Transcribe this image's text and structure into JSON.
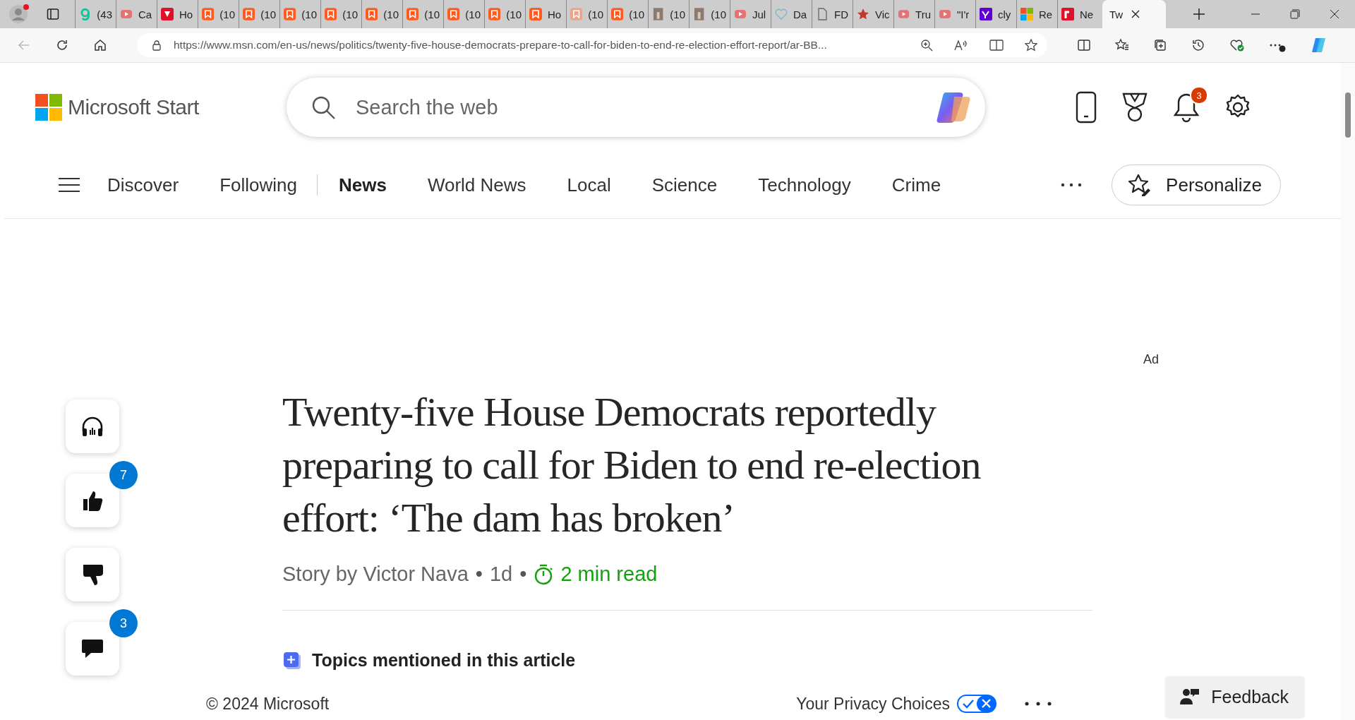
{
  "browser": {
    "tabs": [
      {
        "title": "(43",
        "kind": "grammar",
        "selected": false
      },
      {
        "title": "Ca",
        "kind": "video",
        "selected": false
      },
      {
        "title": "Ho",
        "kind": "shield",
        "selected": false
      },
      {
        "title": "(10",
        "kind": "bookmark",
        "selected": false
      },
      {
        "title": "(10",
        "kind": "bookmark",
        "selected": false
      },
      {
        "title": "(10",
        "kind": "bookmark",
        "selected": false
      },
      {
        "title": "(10",
        "kind": "bookmark",
        "selected": false
      },
      {
        "title": "(10",
        "kind": "bookmark",
        "selected": false
      },
      {
        "title": "(10",
        "kind": "bookmark",
        "selected": false
      },
      {
        "title": "(10",
        "kind": "bookmark",
        "selected": false
      },
      {
        "title": "(10",
        "kind": "bookmark",
        "selected": false
      },
      {
        "title": "Ho",
        "kind": "bookmark",
        "selected": false
      },
      {
        "title": "(10",
        "kind": "bookmark-faded",
        "selected": false
      },
      {
        "title": "(10",
        "kind": "bookmark",
        "selected": false
      },
      {
        "title": "(10",
        "kind": "candle",
        "selected": false
      },
      {
        "title": "(10",
        "kind": "candle",
        "selected": false
      },
      {
        "title": "Jul",
        "kind": "video",
        "selected": false
      },
      {
        "title": "Da",
        "kind": "heart",
        "selected": false
      },
      {
        "title": "FD",
        "kind": "document",
        "selected": false
      },
      {
        "title": "Vic",
        "kind": "star",
        "selected": false
      },
      {
        "title": "Tru",
        "kind": "video",
        "selected": false
      },
      {
        "title": "\"I'r",
        "kind": "video",
        "selected": false
      },
      {
        "title": "cly",
        "kind": "yahoo",
        "selected": false
      },
      {
        "title": "Re",
        "kind": "windows",
        "selected": false
      },
      {
        "title": "Ne",
        "kind": "r",
        "selected": false
      },
      {
        "title": "Tw",
        "kind": "plain",
        "selected": true
      }
    ],
    "url": "https://www.msn.com/en-us/news/politics/twenty-five-house-democrats-prepare-to-call-for-biden-to-end-re-election-effort-report/ar-BB..."
  },
  "header": {
    "brand": "Microsoft Start",
    "search": {
      "placeholder": "Search the web"
    },
    "notification_count": "3"
  },
  "nav": {
    "items": [
      {
        "label": "Discover",
        "selected": false
      },
      {
        "label": "Following",
        "selected": false
      },
      {
        "label": "News",
        "selected": true
      },
      {
        "label": "World News",
        "selected": false
      },
      {
        "label": "Local",
        "selected": false
      },
      {
        "label": "Science",
        "selected": false
      },
      {
        "label": "Technology",
        "selected": false
      },
      {
        "label": "Crime",
        "selected": false
      }
    ],
    "personalize": "Personalize"
  },
  "ad_label": "Ad",
  "actions": [
    {
      "kind": "listen"
    },
    {
      "kind": "like",
      "count": "7"
    },
    {
      "kind": "dislike"
    },
    {
      "kind": "comment",
      "count": "3"
    }
  ],
  "article": {
    "separators": [
      "•",
      "•"
    ],
    "headline": "Twenty-five House Democrats reportedly preparing to call for Biden to end re-election effort: ‘The dam has broken’",
    "author": "Story by Victor Nava",
    "age": "1d",
    "read_time": "2 min read",
    "topics": "Topics mentioned in this article"
  },
  "footer": {
    "copyright": "© 2024 Microsoft",
    "privacy": "Your Privacy Choices",
    "feedback": "Feedback"
  }
}
